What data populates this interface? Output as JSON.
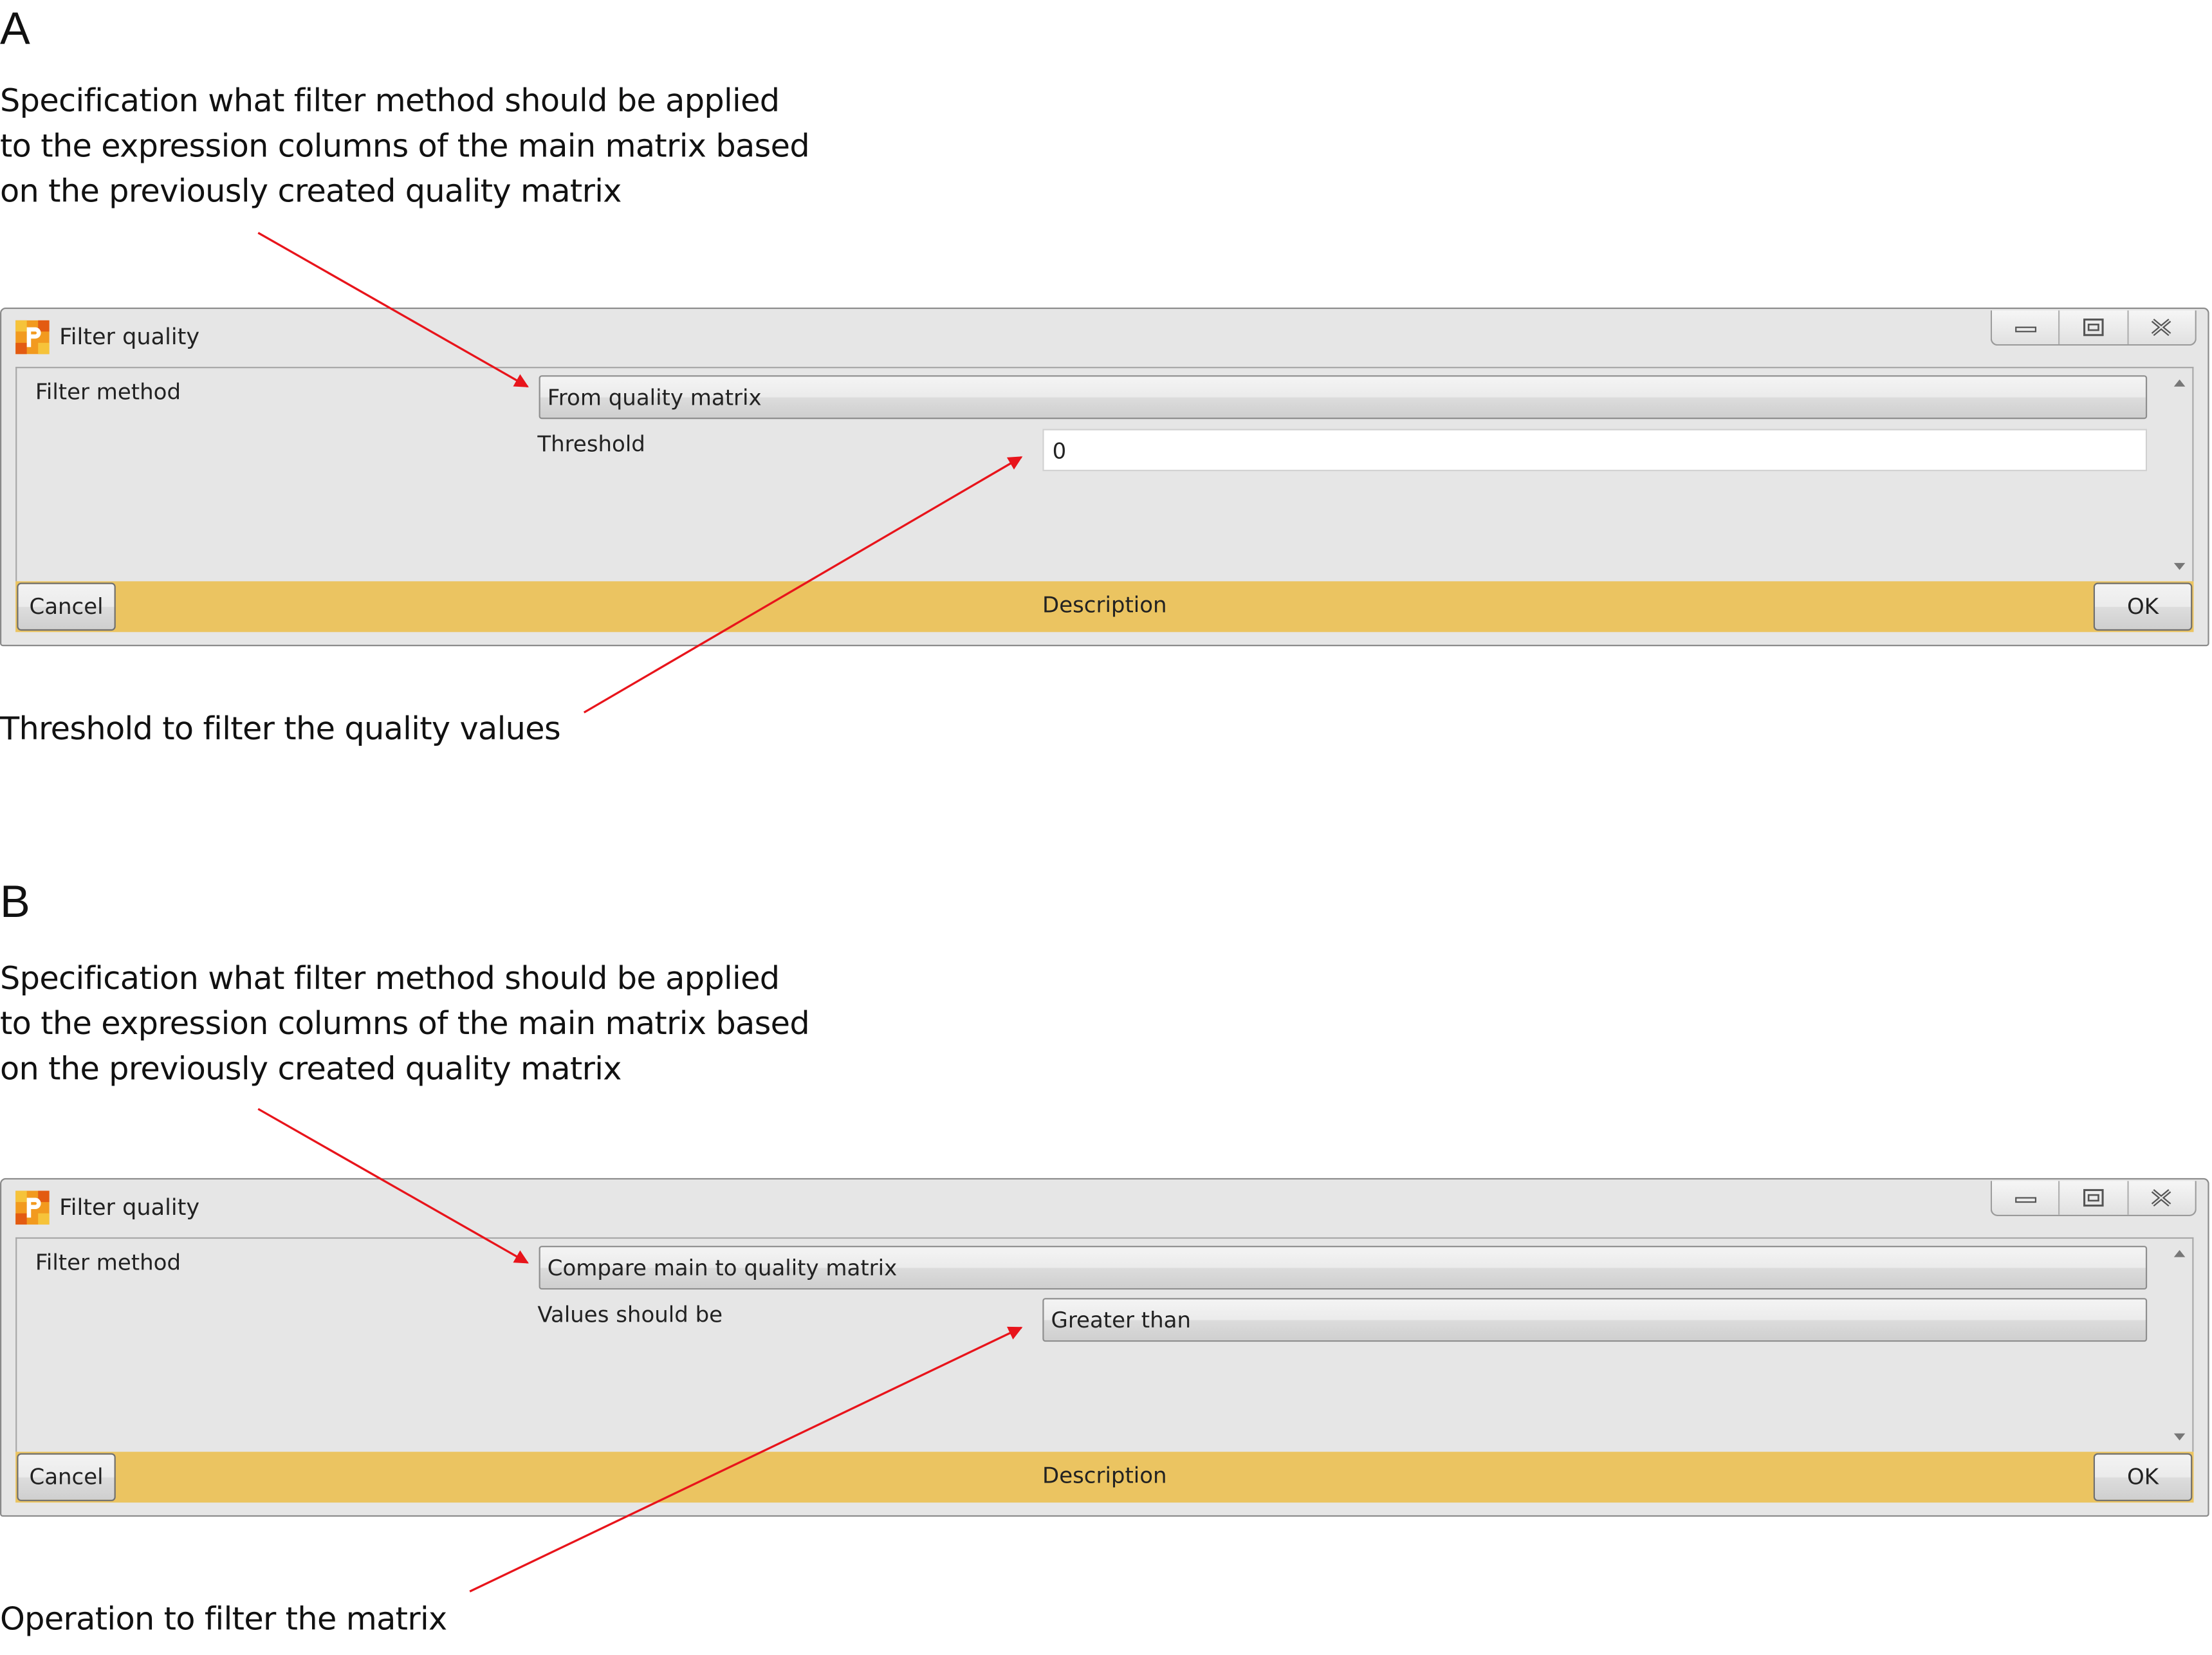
{
  "panelA": {
    "letter": "A",
    "annotation_top": [
      "Specification what filter method should be applied",
      "to the expression columns of the main matrix based",
      "on the previously created quality matrix"
    ],
    "annotation_bottom": "Threshold to filter the quality values",
    "window": {
      "title": "Filter quality",
      "filter_method_label": "Filter method",
      "filter_method_value": "From quality matrix",
      "param_label": "Threshold",
      "param_value": "0",
      "cancel_label": "Cancel",
      "description_label": "Description",
      "ok_label": "OK"
    }
  },
  "panelB": {
    "letter": "B",
    "annotation_top": [
      "Specification what filter method should be applied",
      "to the expression columns of the main matrix based",
      "on the previously created quality matrix"
    ],
    "annotation_bottom": "Operation to filter the matrix",
    "window": {
      "title": "Filter quality",
      "filter_method_label": "Filter method",
      "filter_method_value": "Compare main to quality matrix",
      "param_label": "Values should be",
      "param_value": "Greater than",
      "cancel_label": "Cancel",
      "description_label": "Description",
      "ok_label": "OK"
    }
  },
  "colors": {
    "arrow": "#e8141b",
    "description_bar": "#ebc461"
  },
  "icons": [
    "app-icon",
    "minimize-icon",
    "maximize-icon",
    "close-icon",
    "scroll-up-icon",
    "scroll-down-icon"
  ]
}
